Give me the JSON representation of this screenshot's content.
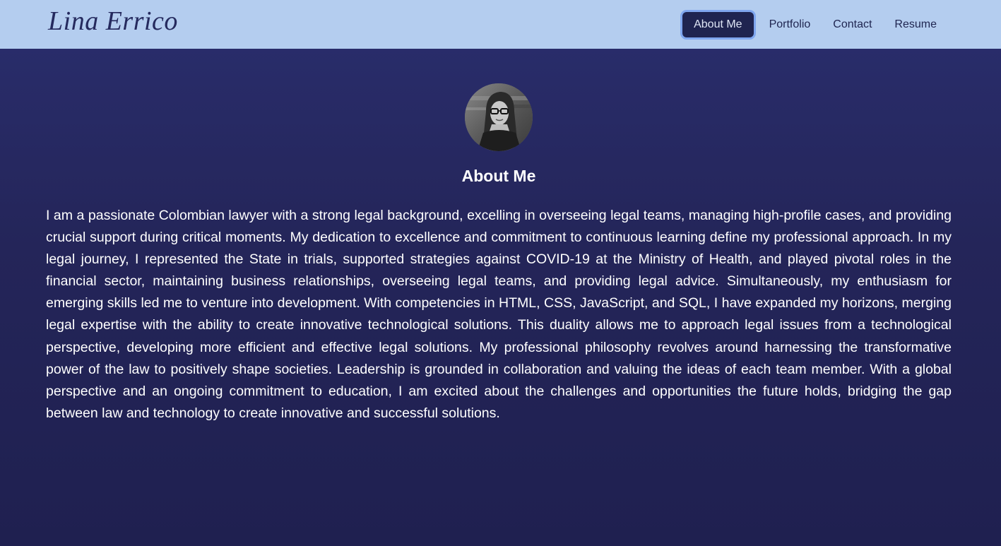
{
  "brand": {
    "name": "Lina Errico"
  },
  "nav": {
    "items": [
      {
        "label": "About Me",
        "active": true
      },
      {
        "label": "Portfolio",
        "active": false
      },
      {
        "label": "Contact",
        "active": false
      },
      {
        "label": "Resume",
        "active": false
      }
    ]
  },
  "about": {
    "heading": "About Me",
    "avatar_icon": "profile-photo",
    "bio": "I am a passionate Colombian lawyer with a strong legal background, excelling in overseeing legal teams, managing high-profile cases, and providing crucial support during critical moments. My dedication to excellence and commitment to continuous learning define my professional approach. In my legal journey, I represented the State in trials, supported strategies against COVID-19 at the Ministry of Health, and played pivotal roles in the financial sector, maintaining business relationships, overseeing legal teams, and providing legal advice. Simultaneously, my enthusiasm for emerging skills led me to venture into development. With competencies in HTML, CSS, JavaScript, and SQL, I have expanded my horizons, merging legal expertise with the ability to create innovative technological solutions. This duality allows me to approach legal issues from a technological perspective, developing more efficient and effective legal solutions. My professional philosophy revolves around harnessing the transformative power of the law to positively shape societies. Leadership is grounded in collaboration and valuing the ideas of each team member. With a global perspective and an ongoing commitment to education, I am excited about the challenges and opportunities the future holds, bridging the gap between law and technology to create innovative and successful solutions."
  },
  "colors": {
    "navbar_bg": "#b4cdef",
    "page_bg_top": "#2a2e6e",
    "page_bg_bottom": "#1f2050",
    "active_nav_bg": "#1f2450",
    "active_nav_ring": "#7fa6ee",
    "text_light": "#ffffff",
    "text_dark": "#1f2550"
  }
}
